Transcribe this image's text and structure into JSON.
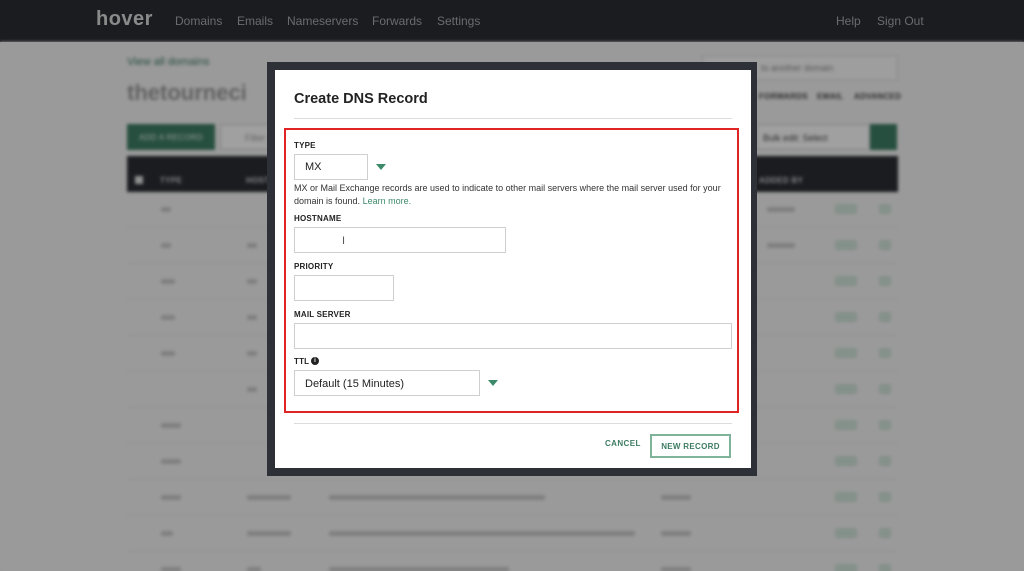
{
  "nav": {
    "logo": "hover",
    "items": [
      "Domains",
      "Emails",
      "Nameservers",
      "Forwards",
      "Settings"
    ],
    "help": "Help",
    "sign_out": "Sign Out"
  },
  "background": {
    "view_all_link": "View all domains",
    "domain_name": "thetourneci",
    "search_placeholder": "to another domain",
    "tabs": [
      "FORWARDS",
      "EMAIL",
      "ADVANCED"
    ],
    "add_record_button": "ADD A RECORD",
    "filter_placeholder": "Filter y",
    "bulk_edit": "Bulk edit: Select",
    "table_headers": [
      "TYPE",
      "HOST",
      "ADDED BY"
    ]
  },
  "modal": {
    "title": "Create DNS Record",
    "type_label": "TYPE",
    "type_value": "MX",
    "help_text": "MX or Mail Exchange records are used to indicate to other mail servers where the mail server used for your domain is found.",
    "learn_more": "Learn more.",
    "hostname_label": "HOSTNAME",
    "hostname_value": "",
    "priority_label": "PRIORITY",
    "priority_value": "",
    "mail_server_label": "MAIL SERVER",
    "mail_server_value": "",
    "ttl_label": "TTL",
    "ttl_value": "Default (15 Minutes)",
    "cancel_button": "CANCEL",
    "new_record_button": "NEW RECORD"
  },
  "colors": {
    "brand_green": "#3d7c63",
    "nav_bg": "#2a2d33",
    "highlight_red": "#e02424"
  }
}
